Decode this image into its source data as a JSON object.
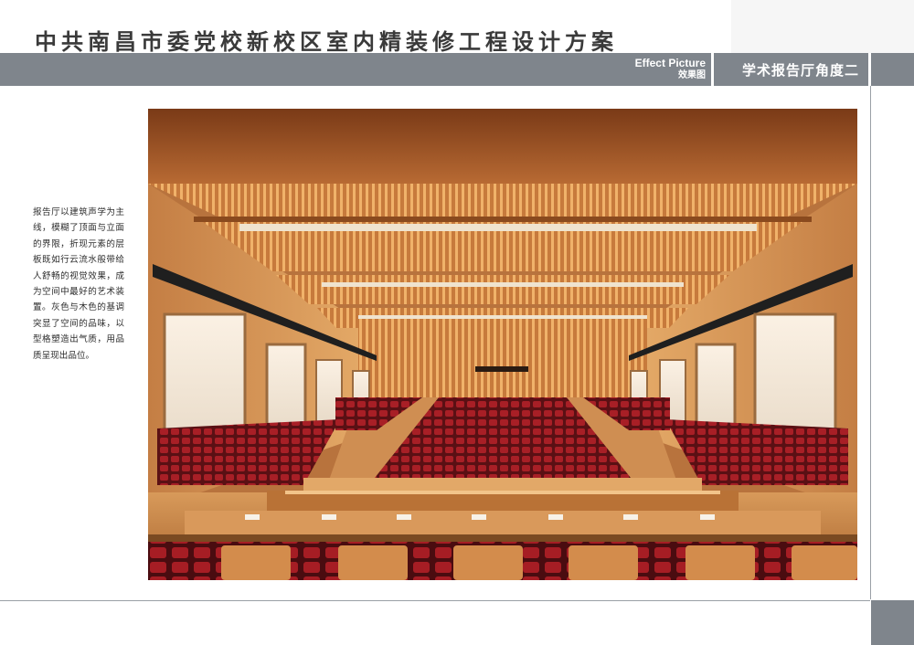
{
  "page": {
    "title": "中共南昌市委党校新校区室内精装修工程设计方案",
    "effect_label_en": "Effect Picture",
    "effect_label_cn": "效果图",
    "view_title": "学术报告厅角度二"
  },
  "description": "报告厅以建筑声学为主线，模糊了顶面与立面的界限，折现元素的层板既如行云流水般带给人舒畅的视觉效果，成为空间中最好的艺术装置。灰色与木色的基调突显了空间的品味，以型格塑造出气质，用品质呈现出品位。",
  "rendering": {
    "subject": "lecture-hall-rendering",
    "colors": {
      "wood": "#c98a4e",
      "ceiling": "#b56a33",
      "seat_red": "#9c1c22",
      "band_gray": "#7f858c"
    }
  }
}
